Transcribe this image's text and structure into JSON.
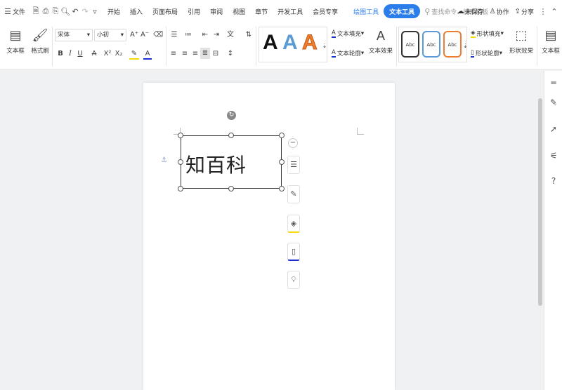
{
  "menu": {
    "file_label": "文件",
    "tabs": [
      "开始",
      "插入",
      "页面布局",
      "引用",
      "审阅",
      "视图",
      "章节",
      "开发工具",
      "会员专享"
    ],
    "draw_tools_label": "绘图工具",
    "text_tools_label": "文本工具",
    "search_placeholder": "查找命令、搜索模板",
    "unsaved_label": "未保存",
    "collab_label": "协作",
    "share_label": "分享"
  },
  "ribbon": {
    "textbox_label": "文本框",
    "format_painter_label": "格式刷",
    "font_family": "宋体",
    "font_size": "小初",
    "text_fill_label": "文本填充",
    "text_outline_label": "文本轮廓",
    "text_effect_label": "文本效果",
    "shape_fill_label": "形状填充",
    "shape_outline_label": "形状轮廓",
    "shape_effect_label": "形状效果",
    "textbox_right_label": "文本框",
    "art_sample": "A",
    "style_sample": "Abc",
    "bold": "B",
    "italic": "I",
    "underline": "U",
    "grow_font": "A⁺",
    "shrink_font": "A⁻",
    "superscript": "X²",
    "subscript": "X₂",
    "strike_a": "A"
  },
  "document": {
    "textbox_text": "知百科"
  },
  "colors": {
    "accent": "#2b7de9",
    "art_black": "#111111",
    "art_blue": "#5b9bd5",
    "art_orange": "#ed7d31",
    "style_black_border": "#333333",
    "style_blue_border": "#5b9bd5",
    "style_orange_border": "#ed7d31"
  }
}
